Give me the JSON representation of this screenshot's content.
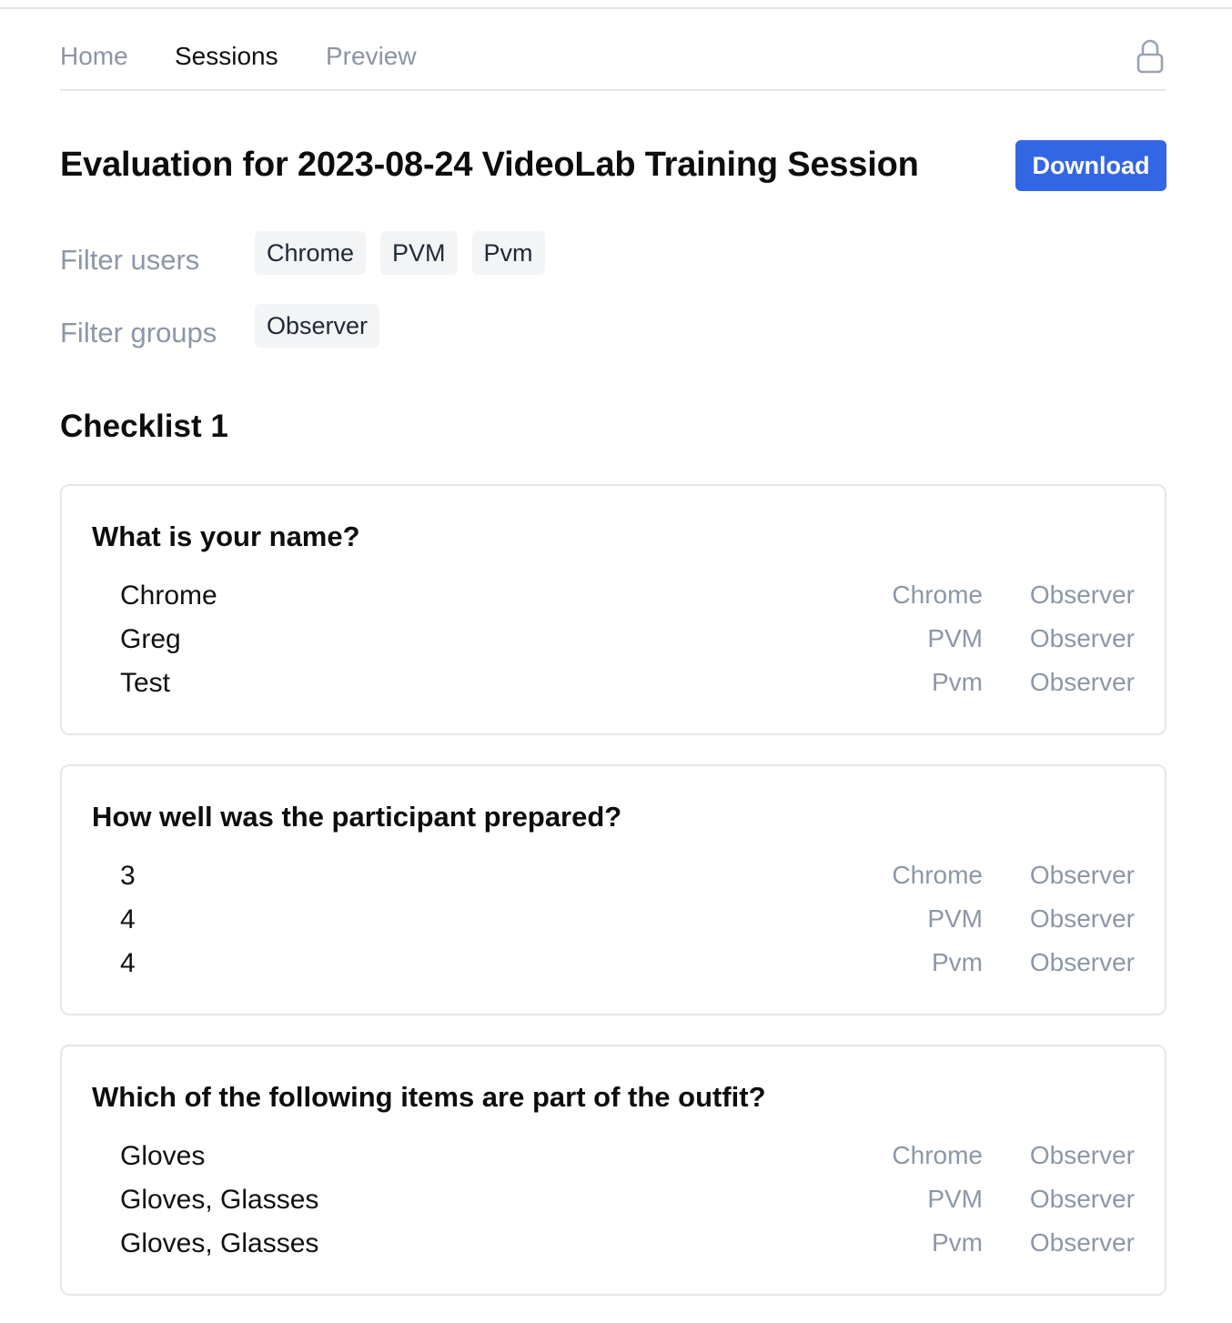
{
  "nav": {
    "links": [
      {
        "label": "Home",
        "active": false
      },
      {
        "label": "Sessions",
        "active": true
      },
      {
        "label": "Preview",
        "active": false
      }
    ],
    "lock_icon": "lock-icon"
  },
  "page": {
    "title": "Evaluation for 2023-08-24 VideoLab Training Session",
    "download_label": "Download",
    "accent_color": "#3366e4"
  },
  "filters": {
    "users": {
      "label": "Filter users",
      "options": [
        "Chrome",
        "PVM",
        "Pvm"
      ]
    },
    "groups": {
      "label": "Filter groups",
      "options": [
        "Observer"
      ]
    }
  },
  "checklist": {
    "title": "Checklist 1",
    "questions": [
      {
        "text": "What is your name?",
        "answers": [
          {
            "value": "Chrome",
            "user": "Chrome",
            "group": "Observer"
          },
          {
            "value": "Greg",
            "user": "PVM",
            "group": "Observer"
          },
          {
            "value": "Test",
            "user": "Pvm",
            "group": "Observer"
          }
        ]
      },
      {
        "text": "How well was the participant prepared?",
        "answers": [
          {
            "value": "3",
            "user": "Chrome",
            "group": "Observer"
          },
          {
            "value": "4",
            "user": "PVM",
            "group": "Observer"
          },
          {
            "value": "4",
            "user": "Pvm",
            "group": "Observer"
          }
        ]
      },
      {
        "text": "Which of the following items are part of the outfit?",
        "answers": [
          {
            "value": "Gloves",
            "user": "Chrome",
            "group": "Observer"
          },
          {
            "value": "Gloves, Glasses",
            "user": "PVM",
            "group": "Observer"
          },
          {
            "value": "Gloves, Glasses",
            "user": "Pvm",
            "group": "Observer"
          }
        ]
      }
    ]
  }
}
